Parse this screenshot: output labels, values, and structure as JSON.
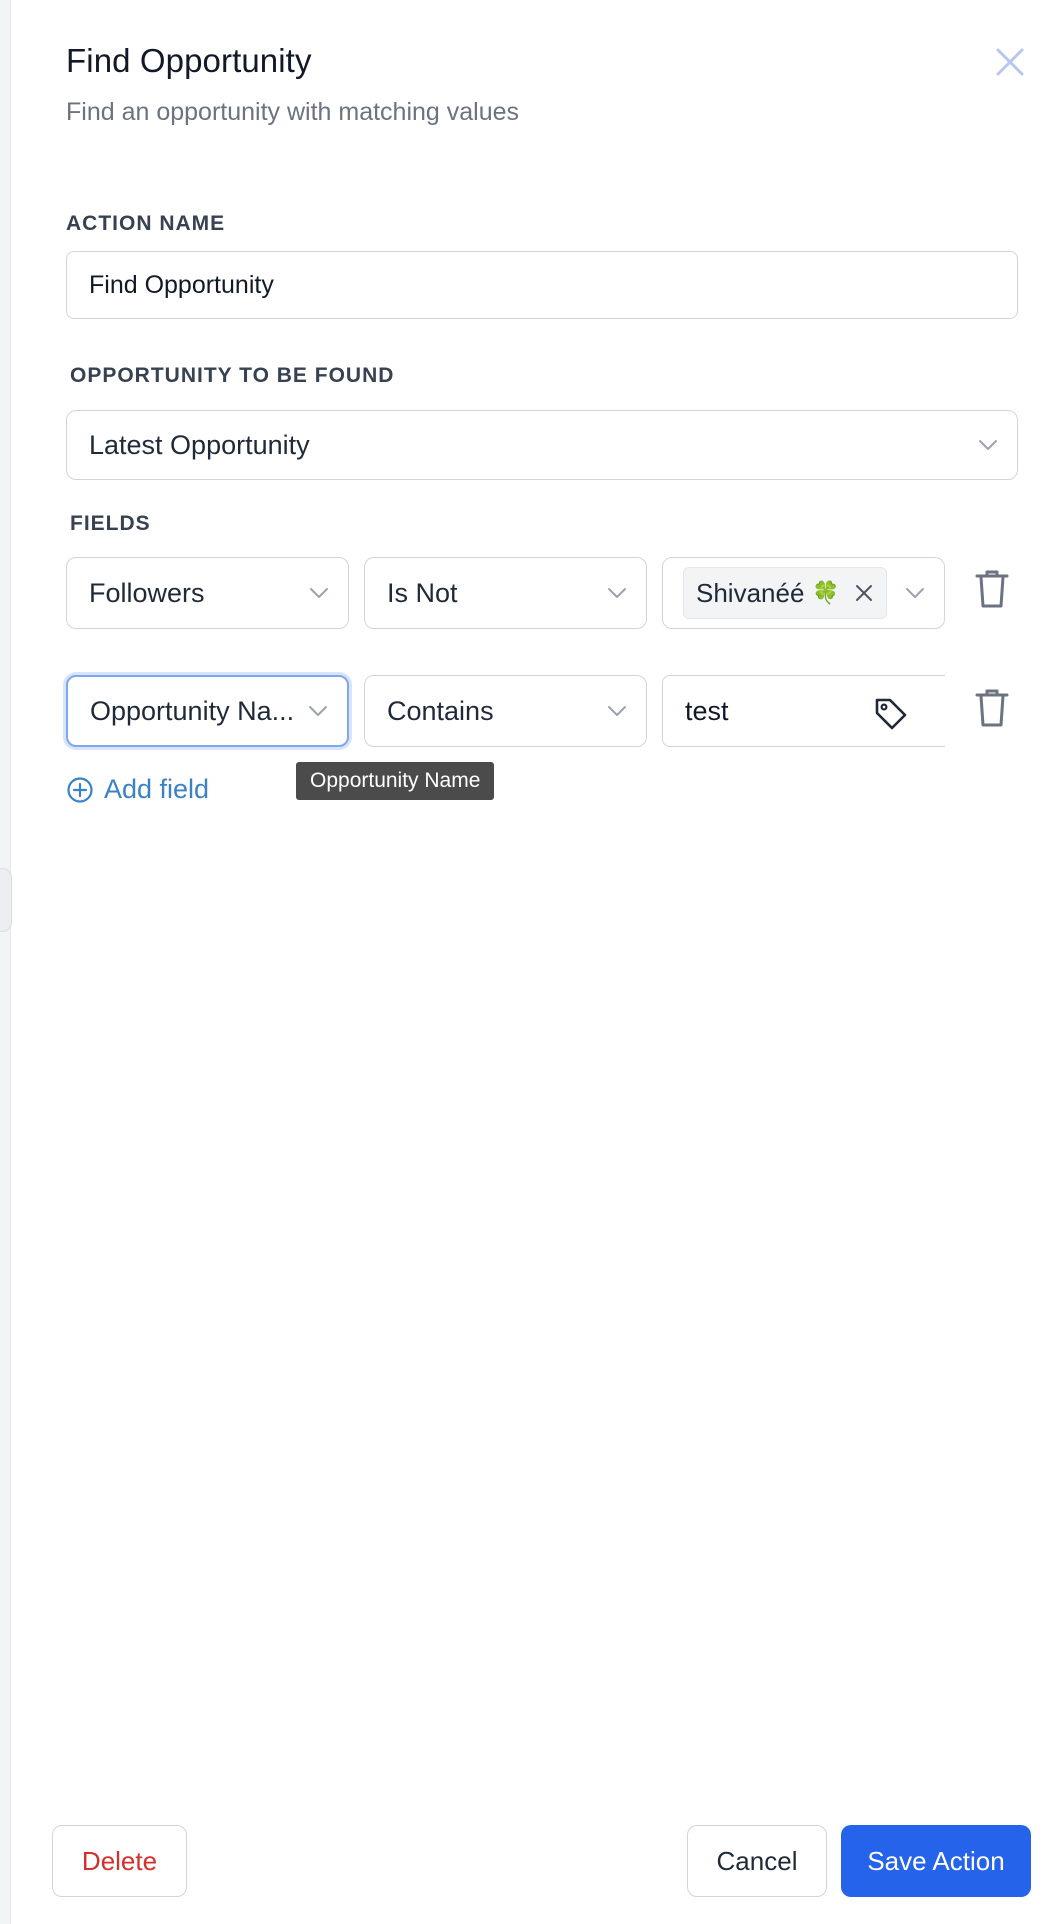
{
  "dialog": {
    "title": "Find Opportunity",
    "subtitle": "Find an opportunity with matching values"
  },
  "action_name": {
    "label": "ACTION NAME",
    "value": "Find Opportunity"
  },
  "opportunity": {
    "label": "OPPORTUNITY TO BE FOUND",
    "selected": "Latest Opportunity"
  },
  "fields": {
    "label": "FIELDS",
    "rows": [
      {
        "field": "Followers",
        "operator": "Is Not",
        "chip": "Shivanéé",
        "chip_emoji": "🍀"
      },
      {
        "field": "Opportunity Na...",
        "operator": "Contains",
        "value": "test"
      }
    ],
    "tooltip": "Opportunity Name",
    "add_label": "Add field"
  },
  "footer": {
    "delete_label": "Delete",
    "cancel_label": "Cancel",
    "save_label": "Save Action"
  },
  "colors": {
    "primary": "#2563eb",
    "danger": "#d0312d",
    "link": "#3b82c4",
    "focus": "#7fa7ee"
  }
}
